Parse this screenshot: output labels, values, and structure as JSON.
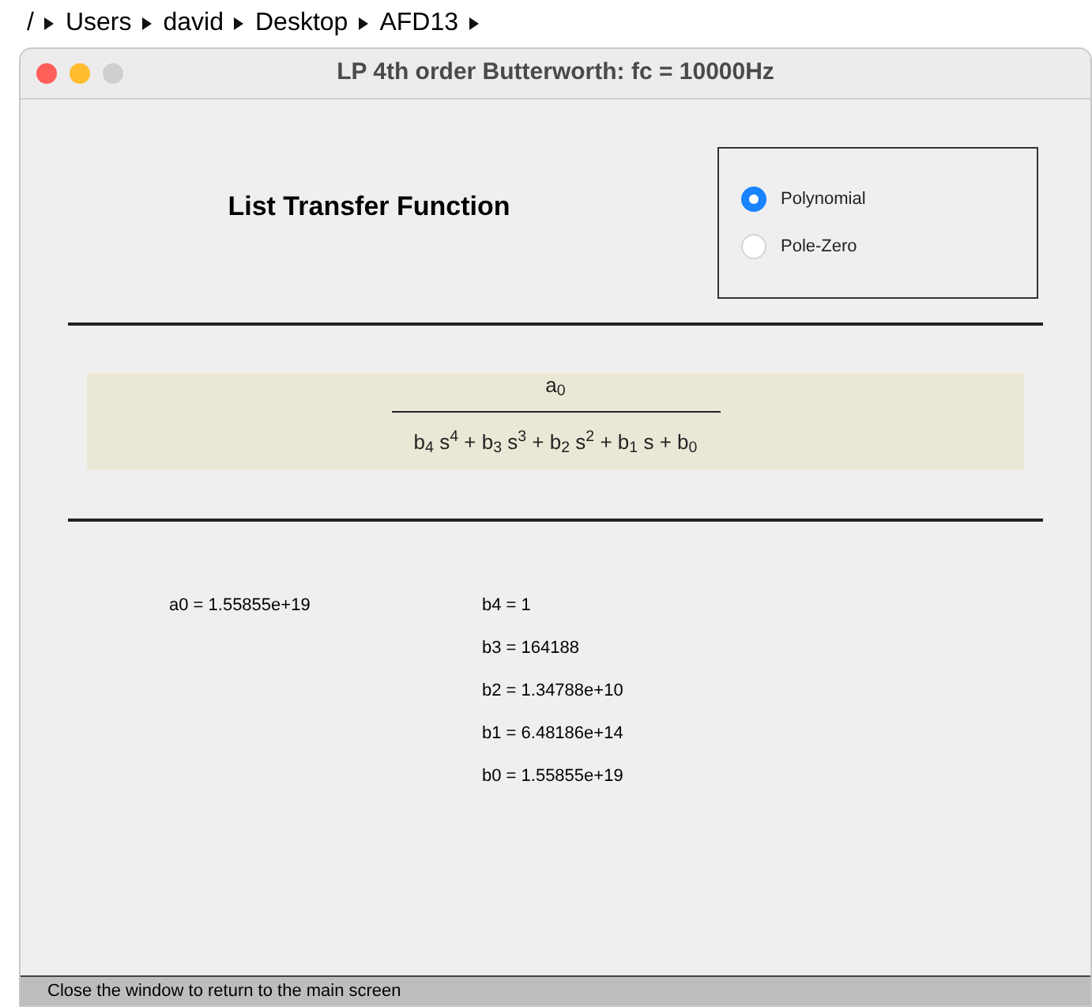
{
  "breadcrumb": [
    "/",
    "Users",
    "david",
    "Desktop",
    "AFD13"
  ],
  "window": {
    "title": "LP 4th order Butterworth: fc = 10000Hz"
  },
  "heading": "List Transfer Function",
  "view_options": [
    {
      "label": "Polynomial",
      "selected": true
    },
    {
      "label": "Pole-Zero",
      "selected": false
    }
  ],
  "formula": {
    "numerator": "a$_{0}$",
    "denominator": "b$_{4}$ s$^{4}$ + b$_{3}$ s$^{3}$ + b$_{2}$ s$^{2}$ + b$_{1}$ s + b$_{0}$"
  },
  "numerator_coefficients": [
    "a0 = 1.55855e+19"
  ],
  "denominator_coefficients": [
    "b4 = 1",
    "b3 = 164188",
    "b2 = 1.34788e+10",
    "b1 = 6.48186e+14",
    "b0 = 1.55855e+19"
  ],
  "status_bar": "Close the window to return to the main screen"
}
